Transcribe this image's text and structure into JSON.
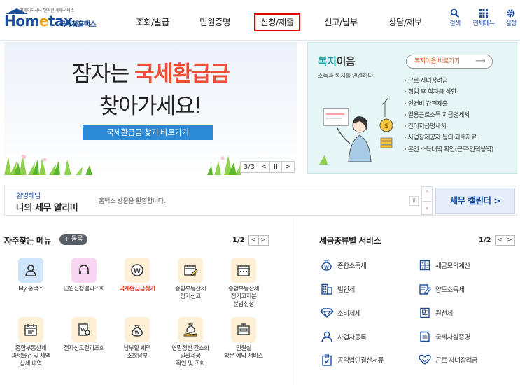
{
  "header": {
    "logo_small": "언제어디서나 편리한 세무서비스",
    "logo_main_pre": "Hom",
    "logo_main_dot": "e",
    "logo_main_post": "tax.",
    "logo_sub": "국세청홈택스",
    "nav": [
      "조회/발급",
      "민원증명",
      "신청/제출",
      "신고/납부",
      "상담/제보"
    ],
    "active_nav": "신청/제출",
    "utils": [
      {
        "label": "검색",
        "icon": "search-icon"
      },
      {
        "label": "전체메뉴",
        "icon": "grid-menu-icon"
      },
      {
        "label": "설정",
        "icon": "gear-icon"
      }
    ],
    "accent": "#1a4c9c",
    "active_border": "#e60000"
  },
  "banner": {
    "line1_pre": "잠자는 ",
    "line1_highlight": "국세환급금",
    "line2": "찾아가세요!",
    "button": "국세환급금 찾기 바로가기",
    "counter": "3/3",
    "prev": "<",
    "pause": "II",
    "next": ">",
    "highlight_color": "#f04c36",
    "button_color": "#2c89d6"
  },
  "welfare": {
    "title_accent": "복지",
    "title_rest": "이음",
    "subtitle": "소득과 복지를 연결하다!",
    "link": "복지이음 바로가기",
    "items": [
      "근로·자녀장려금",
      "취업 후 학자금 상환",
      "인건비 간편제출",
      "일용근로소득 지급명세서",
      "간이지급명세서",
      "사업장제공자 등의 과세자료",
      "본인 소득내역 확인(근로·인적용역)"
    ],
    "accent": "#15a3a3"
  },
  "notice": {
    "kicker": "환영해님",
    "title": "나의 세무 알리미",
    "message": "홈택스 방문을 환영합니다.",
    "pause": "II",
    "up": "^",
    "down": "v",
    "calendar": "세무 캘린더 >"
  },
  "frequent": {
    "title": "자주찾는 메뉴",
    "register": "+ 등록",
    "page": "1/2",
    "prev": "<",
    "next": ">",
    "items": [
      {
        "label": "My 홈택스",
        "icon": "user-icon",
        "bg": "#cfe5fb"
      },
      {
        "label": "민원신청결과조회",
        "icon": "headset-icon",
        "bg": "#f9d6f2"
      },
      {
        "label": "국세환급금찾기",
        "icon": "refund-coin-icon",
        "bg": "#fdf0d6",
        "highlight": true
      },
      {
        "label": "종합부동산세\n정기신고",
        "icon": "calendar-edit-icon",
        "bg": "#fdf0d6"
      },
      {
        "label": "종합부동산세\n정기고지분\n분납신청",
        "icon": "calendar-icon",
        "bg": "#fdf0d6"
      },
      {
        "label": "종합부동산세\n과세물건 및 세액\n상세 내역",
        "icon": "calendar-list-icon",
        "bg": "#fdf0d6"
      },
      {
        "label": "전자신고결과조회",
        "icon": "document-search-icon",
        "bg": "#fdf0d6"
      },
      {
        "label": "납부할 세액\n조회납부",
        "icon": "money-bag-icon",
        "bg": "#fdf0d6"
      },
      {
        "label": "연말정산 간소화\n일괄제공\n확인 및 조회",
        "icon": "money-bag-hand-icon",
        "bg": "#fdf0d6"
      },
      {
        "label": "민원실\n방문 예약 서비스",
        "icon": "reservation-icon",
        "bg": "#fdf0d6"
      }
    ]
  },
  "tax_services": {
    "title": "세금종류별 서비스",
    "page": "1/2",
    "prev": "<",
    "next": ">",
    "items": [
      {
        "label": "종합소득세",
        "icon": "money-bag-icon"
      },
      {
        "label": "세금모의계산",
        "icon": "calculator-icon"
      },
      {
        "label": "법인세",
        "icon": "building-icon"
      },
      {
        "label": "양도소득세",
        "icon": "document-edit-icon"
      },
      {
        "label": "소비제세",
        "icon": "diamond-icon"
      },
      {
        "label": "원천세",
        "icon": "receipt-icon"
      },
      {
        "label": "사업자등록",
        "icon": "person-register-icon"
      },
      {
        "label": "국세사실증명",
        "icon": "certificate-icon"
      },
      {
        "label": "공익법인결산서류",
        "icon": "clipboard-check-icon"
      },
      {
        "label": "근로·자녀장려금",
        "icon": "heart-hands-icon"
      }
    ]
  }
}
